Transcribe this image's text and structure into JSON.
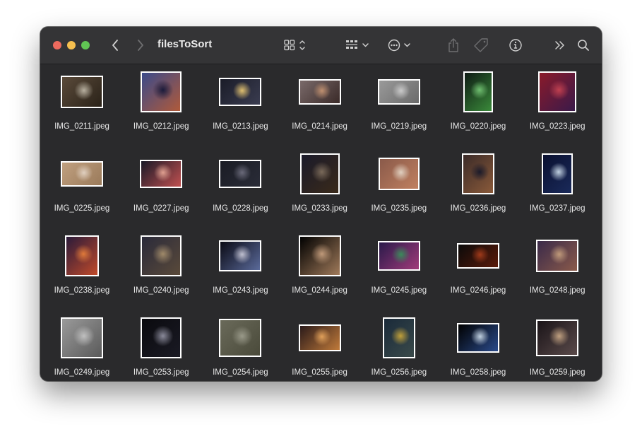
{
  "window": {
    "title": "filesToSort"
  },
  "toolbar": {
    "back_icon": "chevron-left-icon",
    "forward_icon": "chevron-right-icon",
    "view_icon": "icon-grid-icon",
    "group_icon": "group-by-icon",
    "action_icon": "ellipsis-circle-icon",
    "share_icon": "share-icon",
    "tag_icon": "tag-icon",
    "info_icon": "info-icon",
    "overflow_icon": "double-chevron-right-icon",
    "search_icon": "search-icon"
  },
  "files": [
    {
      "name": "IMG_0211.jpeg",
      "colors": [
        "#5a4a3a",
        "#2a2218",
        "#b8b0a0"
      ]
    },
    {
      "name": "IMG_0212.jpeg",
      "colors": [
        "#3a4a8a",
        "#b05a3a",
        "#1a1a3a"
      ]
    },
    {
      "name": "IMG_0213.jpeg",
      "colors": [
        "#1a1c28",
        "#3a3c50",
        "#e0c070"
      ]
    },
    {
      "name": "IMG_0214.jpeg",
      "colors": [
        "#7a6a6a",
        "#3a2a28",
        "#c09070"
      ]
    },
    {
      "name": "IMG_0219.jpeg",
      "colors": [
        "#9a9a9a",
        "#6a6a6a",
        "#cacaca"
      ]
    },
    {
      "name": "IMG_0220.jpeg",
      "colors": [
        "#0e1a14",
        "#3a8a3a",
        "#70c070"
      ]
    },
    {
      "name": "IMG_0223.jpeg",
      "colors": [
        "#8a1a2a",
        "#3a1a4a",
        "#c04050"
      ]
    },
    {
      "name": "IMG_0225.jpeg",
      "colors": [
        "#c0a080",
        "#9a7a5a",
        "#e0d0c0"
      ]
    },
    {
      "name": "IMG_0227.jpeg",
      "colors": [
        "#1a1a28",
        "#c05050",
        "#e0a090"
      ]
    },
    {
      "name": "IMG_0228.jpeg",
      "colors": [
        "#1a1c24",
        "#2a2c38",
        "#6a6a7a"
      ]
    },
    {
      "name": "IMG_0233.jpeg",
      "colors": [
        "#1a1a2a",
        "#3a2a1a",
        "#7a6a5a"
      ]
    },
    {
      "name": "IMG_0235.jpeg",
      "colors": [
        "#8a5a4a",
        "#c08060",
        "#e0d0c0"
      ]
    },
    {
      "name": "IMG_0236.jpeg",
      "colors": [
        "#3a2a28",
        "#8a5a3a",
        "#1a1a2a"
      ]
    },
    {
      "name": "IMG_0237.jpeg",
      "colors": [
        "#0a1030",
        "#1a2a5a",
        "#c0d0e0"
      ]
    },
    {
      "name": "IMG_0238.jpeg",
      "colors": [
        "#2a1a3a",
        "#c04a2a",
        "#e07a3a"
      ]
    },
    {
      "name": "IMG_0240.jpeg",
      "colors": [
        "#2a2a3a",
        "#5a4a3a",
        "#a08a6a"
      ]
    },
    {
      "name": "IMG_0243.jpeg",
      "colors": [
        "#0a0a14",
        "#5a6a9a",
        "#c0c0d0"
      ]
    },
    {
      "name": "IMG_0244.jpeg",
      "colors": [
        "#000000",
        "#a07a5a",
        "#c09a7a"
      ]
    },
    {
      "name": "IMG_0245.jpeg",
      "colors": [
        "#2a1a4a",
        "#a03a7a",
        "#3a8a5a"
      ]
    },
    {
      "name": "IMG_0246.jpeg",
      "colors": [
        "#0a0a0a",
        "#5a1a0a",
        "#a03a1a"
      ]
    },
    {
      "name": "IMG_0248.jpeg",
      "colors": [
        "#3a2a4a",
        "#8a5a4a",
        "#c09a7a"
      ]
    },
    {
      "name": "IMG_0249.jpeg",
      "colors": [
        "#9a9a9a",
        "#5a5a5a",
        "#c0c0c0"
      ]
    },
    {
      "name": "IMG_0253.jpeg",
      "colors": [
        "#0a0a0e",
        "#1a1a24",
        "#8a8a9a"
      ]
    },
    {
      "name": "IMG_0254.jpeg",
      "colors": [
        "#6a6a5a",
        "#4a4a3a",
        "#9a9a8a"
      ]
    },
    {
      "name": "IMG_0255.jpeg",
      "colors": [
        "#2a1a1a",
        "#c07a3a",
        "#e0a05a"
      ]
    },
    {
      "name": "IMG_0256.jpeg",
      "colors": [
        "#1a2a3a",
        "#3a4a4a",
        "#c0a03a"
      ]
    },
    {
      "name": "IMG_0258.jpeg",
      "colors": [
        "#000000",
        "#2a4a8a",
        "#c0d0e0"
      ]
    },
    {
      "name": "IMG_0259.jpeg",
      "colors": [
        "#1a1418",
        "#5a4a4a",
        "#c0a080"
      ]
    }
  ]
}
